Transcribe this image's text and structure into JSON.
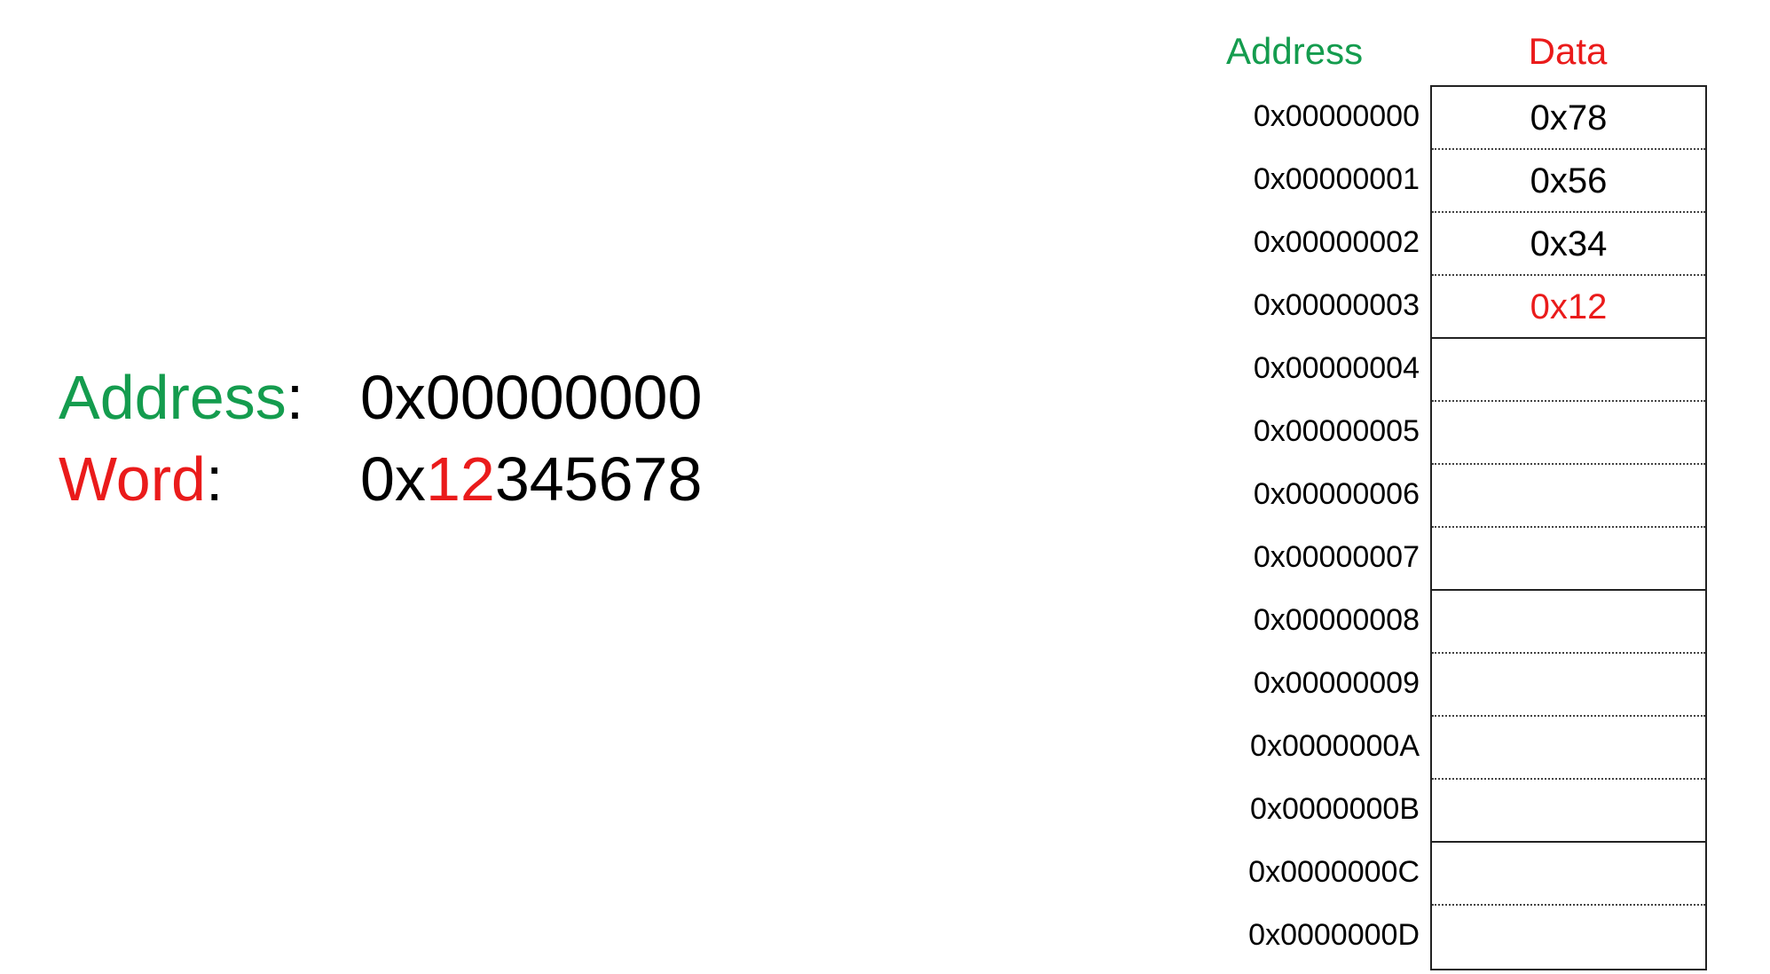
{
  "left": {
    "address_label": "Address",
    "address_colon": ":",
    "address_value": "0x00000000",
    "word_label": "Word",
    "word_colon": ":",
    "word_value_prefix": "0x",
    "word_value_highlight": "12",
    "word_value_rest": "345678"
  },
  "table": {
    "address_header": "Address",
    "data_header": "Data",
    "rows": [
      {
        "address": "0x00000000",
        "data": "0x78",
        "highlight": false
      },
      {
        "address": "0x00000001",
        "data": "0x56",
        "highlight": false
      },
      {
        "address": "0x00000002",
        "data": "0x34",
        "highlight": false
      },
      {
        "address": "0x00000003",
        "data": "0x12",
        "highlight": true
      },
      {
        "address": "0x00000004",
        "data": "",
        "highlight": false
      },
      {
        "address": "0x00000005",
        "data": "",
        "highlight": false
      },
      {
        "address": "0x00000006",
        "data": "",
        "highlight": false
      },
      {
        "address": "0x00000007",
        "data": "",
        "highlight": false
      },
      {
        "address": "0x00000008",
        "data": "",
        "highlight": false
      },
      {
        "address": "0x00000009",
        "data": "",
        "highlight": false
      },
      {
        "address": "0x0000000A",
        "data": "",
        "highlight": false
      },
      {
        "address": "0x0000000B",
        "data": "",
        "highlight": false
      },
      {
        "address": "0x0000000C",
        "data": "",
        "highlight": false
      },
      {
        "address": "0x0000000D",
        "data": "",
        "highlight": false
      }
    ]
  },
  "colors": {
    "green": "#149c4e",
    "red": "#ea1b1b"
  }
}
